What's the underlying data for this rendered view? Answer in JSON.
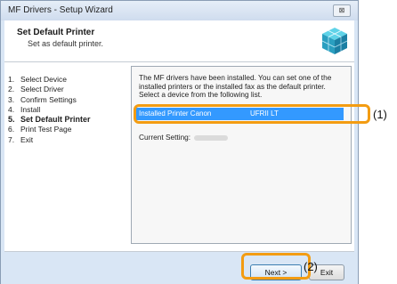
{
  "window": {
    "title": "MF Drivers - Setup Wizard",
    "close_label": "⊠"
  },
  "header": {
    "title": "Set Default Printer",
    "subtitle": "Set as default printer."
  },
  "steps": [
    {
      "num": "1.",
      "label": "Select Device",
      "current": false
    },
    {
      "num": "2.",
      "label": "Select Driver",
      "current": false
    },
    {
      "num": "3.",
      "label": "Confirm Settings",
      "current": false
    },
    {
      "num": "4.",
      "label": "Install",
      "current": false
    },
    {
      "num": "5.",
      "label": "Set Default Printer",
      "current": true
    },
    {
      "num": "6.",
      "label": "Print Test Page",
      "current": false
    },
    {
      "num": "7.",
      "label": "Exit",
      "current": false
    }
  ],
  "panel": {
    "description": "The MF drivers have been installed. You can set one of the installed printers or the installed fax as the default printer. Select a device from the following list.",
    "selected_device": "Installed Printer Canon",
    "selected_driver": "UFRII LT",
    "current_setting_label": "Current Setting:"
  },
  "footer": {
    "next_label": "Next >",
    "exit_label": "Exit"
  },
  "callouts": {
    "one": "(1)",
    "two": "(2)"
  },
  "colors": {
    "accent": "#f39c12",
    "selection": "#3399ff"
  }
}
